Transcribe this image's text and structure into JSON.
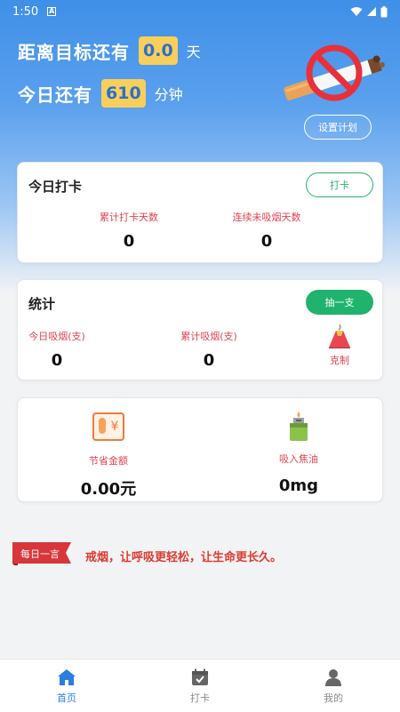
{
  "status_bar": {
    "time": "1:50",
    "notification_glyph": "A"
  },
  "hero": {
    "row1": {
      "label": "距离目标还有",
      "value": "0.0",
      "unit": "天"
    },
    "row2": {
      "label": "今日还有",
      "value": "610",
      "unit": "分钟"
    },
    "plan_button": "设置计划",
    "illustration": "no-smoking-icon"
  },
  "checkin_card": {
    "title": "今日打卡",
    "button": "打卡",
    "stats": [
      {
        "label": "累计打卡天数",
        "value": "0"
      },
      {
        "label": "连续未吸烟天数",
        "value": "0"
      }
    ]
  },
  "stats_card": {
    "title": "统计",
    "button": "抽一支",
    "stats": [
      {
        "label": "今日吸烟(支)",
        "value": "0"
      },
      {
        "label": "累计吸烟(支)",
        "value": "0"
      }
    ],
    "restrain": {
      "icon": "volcano-icon",
      "label": "克制"
    }
  },
  "savings_card": {
    "money": {
      "icon": "money-icon",
      "label": "节省金额",
      "value": "0.00元"
    },
    "tar": {
      "icon": "lighter-icon",
      "label": "吸入焦油",
      "value": "0mg"
    }
  },
  "daily_quote": {
    "tag": "每日一言",
    "text": "戒烟，让呼吸更轻松，让生命更长久。"
  },
  "tabs": [
    {
      "label": "首页",
      "icon": "home-icon",
      "active": true
    },
    {
      "label": "打卡",
      "icon": "calendar-check-icon",
      "active": false
    },
    {
      "label": "我的",
      "icon": "user-icon",
      "active": false
    }
  ],
  "colors": {
    "primary_blue": "#2b7de0",
    "accent_yellow": "#f7cf5a",
    "accent_green": "#1fb36d",
    "accent_red": "#e0434f"
  }
}
